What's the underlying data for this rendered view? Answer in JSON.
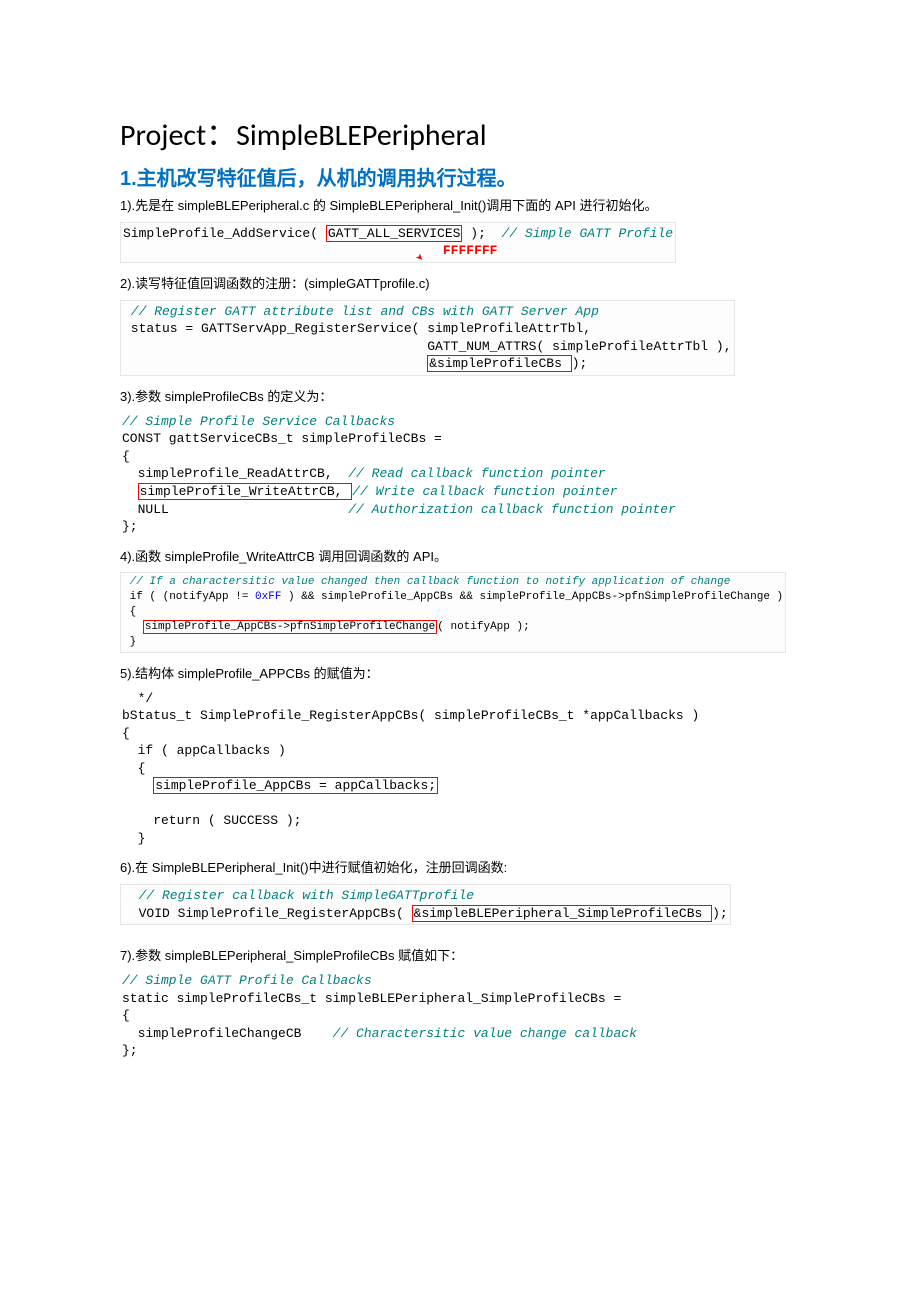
{
  "title": "Project：SimpleBLEPeripheral",
  "section1_heading": "1.主机改写特征值后，从机的调用执行过程。",
  "p1": "1).先是在 simpleBLEPeripheral.c 的 SimpleBLEPeripheral_Init()调用下面的 API 进行初始化。",
  "code1_a": "SimpleProfile_AddService( ",
  "code1_b": "GATT_ALL_SERVICES",
  "code1_c": " );  ",
  "code1_comment": "// Simple GATT Profile",
  "code1_red": "FFFFFFF",
  "p2": "2).读写特征值回调函数的注册：(simpleGATTprofile.c)",
  "code2_c1": " // Register GATT attribute list and CBs with GATT Server App",
  "code2_l2": " status = GATTServApp_RegisterService( simpleProfileAttrTbl,",
  "code2_l3": "                                       GATT_NUM_ATTRS( simpleProfileAttrTbl ),",
  "code2_l4a": "                                       ",
  "code2_l4b": "&simpleProfileCBs ",
  "code2_l4c": ");",
  "p3": "3).参数 simpleProfileCBs 的定义为：",
  "code3_c1": "// Simple Profile Service Callbacks",
  "code3_l2": "CONST gattServiceCBs_t simpleProfileCBs =",
  "code3_l3": "{",
  "code3_l4a": "  simpleProfile_ReadAttrCB,  ",
  "code3_l4c": "// Read callback function pointer",
  "code3_l5a": "  ",
  "code3_l5b": "simpleProfile_WriteAttrCB, ",
  "code3_l5c": "// Write callback function pointer",
  "code3_l6a": "  NULL                       ",
  "code3_l6c": "// Authorization callback function pointer",
  "code3_l7": "};",
  "p4": "4).函数 simpleProfile_WriteAttrCB 调用回调函数的 API。",
  "code4_c1": " // If a charactersitic value changed then callback function to notify application of change",
  "code4_l2a": " if ( (notifyApp != ",
  "code4_l2b": "0xFF",
  "code4_l2c": " ) && simpleProfile_AppCBs && simpleProfile_AppCBs->pfnSimpleProfileChange )",
  "code4_l3": " {",
  "code4_l4a": "   ",
  "code4_l4b": "simpleProfile_AppCBs->pfnSimpleProfileChange",
  "code4_l4c": "( notifyApp );",
  "code4_l5": " }",
  "p5": "5).结构体 simpleProfile_APPCBs 的赋值为：",
  "code5_l1": "  */",
  "code5_l2": "bStatus_t SimpleProfile_RegisterAppCBs( simpleProfileCBs_t *appCallbacks )",
  "code5_l3": "{",
  "code5_l4": "  if ( appCallbacks )",
  "code5_l5": "  {",
  "code5_l6a": "    ",
  "code5_l6b": "simpleProfile_AppCBs = appCallbacks;",
  "code5_blank": " ",
  "code5_l7": "    return ( SUCCESS );",
  "code5_l8": "  }",
  "p6": "6).在 SimpleBLEPeripheral_Init()中进行赋值初始化，注册回调函数:",
  "code6_c1": "  // Register callback with SimpleGATTprofile",
  "code6_l2a": "  VOID SimpleProfile_RegisterAppCBs( ",
  "code6_l2b": "&simpleBLEPeripheral_SimpleProfileCBs ",
  "code6_l2c": ");",
  "p7": "7).参数 simpleBLEPeripheral_SimpleProfileCBs 赋值如下：",
  "code7_c1": "// Simple GATT Profile Callbacks",
  "code7_l2": "static simpleProfileCBs_t simpleBLEPeripheral_SimpleProfileCBs =",
  "code7_l3": "{",
  "code7_l4a": "  simpleProfileChangeCB    ",
  "code7_l4c": "// Charactersitic value change callback",
  "code7_l5": "};"
}
